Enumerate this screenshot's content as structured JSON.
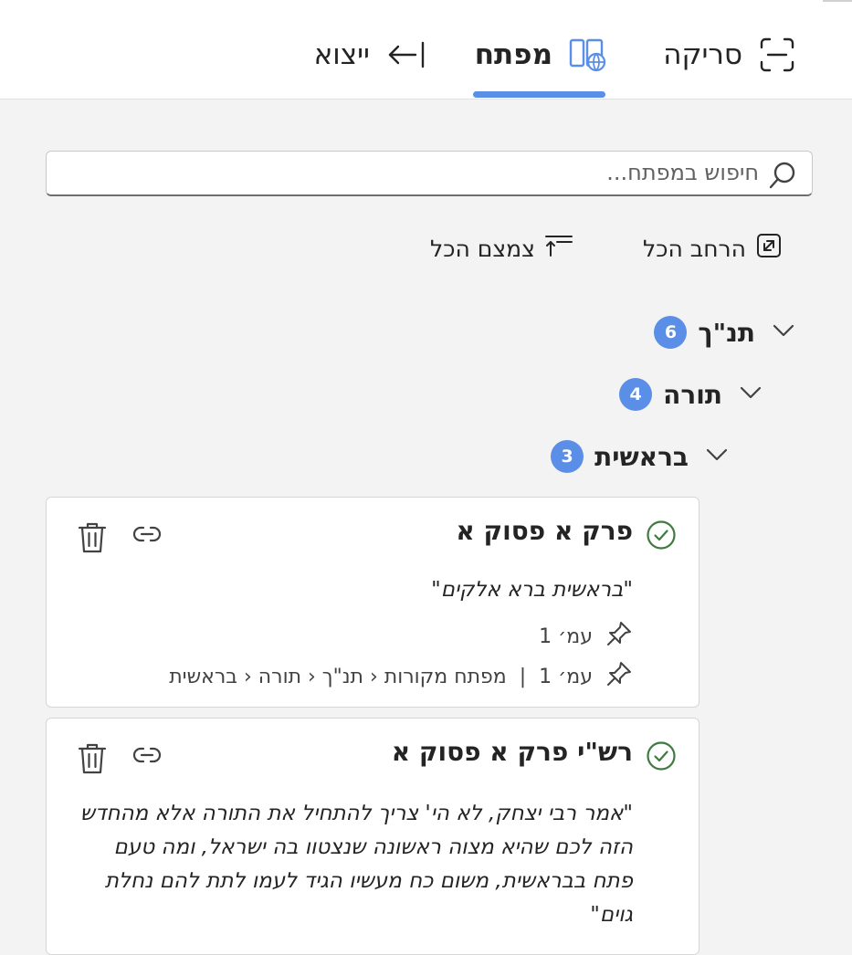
{
  "tabs": {
    "scan": "סריקה",
    "index": "מפתח",
    "logout": "ייצוא"
  },
  "search": {
    "placeholder": "חיפוש במפתח..."
  },
  "actions": {
    "expand_all": "הרחב הכל",
    "collapse_all": "צמצם הכל"
  },
  "tree": {
    "tanakh": {
      "label": "תנ\"ך",
      "count": "6"
    },
    "torah": {
      "label": "תורה",
      "count": "4"
    },
    "bereshit": {
      "label": "בראשית",
      "count": "3"
    }
  },
  "cards": [
    {
      "title": "פרק א פסוק א",
      "quote": "\"בראשית ברא אלקים\"",
      "page": "עמ׳ 1",
      "source_page": "עמ׳ 1",
      "separator": "|",
      "breadcrumb": "מפתח מקורות ‹ תנ\"ך ‹ תורה ‹ בראשית"
    },
    {
      "title": "רש\"י פרק א פסוק א",
      "quote": "\"אמר רבי יצחק, לא הי' צריך להתחיל את התורה אלא מהחדש הזה לכם שהיא מצוה ראשונה שנצטוו בה ישראל, ומה טעם פתח בבראשית, משום כח מעשיו הגיד לעמו לתת להם נחלת גוים\""
    }
  ],
  "colors": {
    "accent": "#5b8ee6",
    "check": "#3f7a3f",
    "background": "#f3f3f3",
    "card": "#ffffff"
  },
  "icons": [
    "scan-icon",
    "index-book-icon",
    "logout-icon",
    "search-icon",
    "expand-icon",
    "collapse-icon",
    "chevron-down-icon",
    "check-circle-icon",
    "link-icon",
    "trash-icon",
    "pin-icon"
  ]
}
